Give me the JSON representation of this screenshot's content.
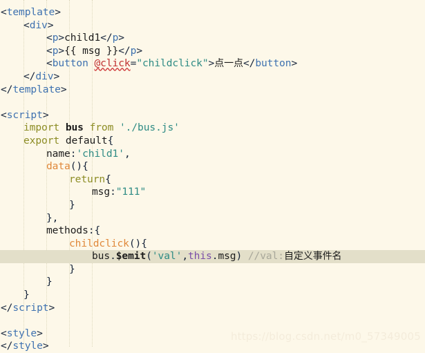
{
  "editor": {
    "language": "vue",
    "background_color": "#fdf8e9",
    "highlight_line_color": "#e3dfc9",
    "highlighted_line_number": 20
  },
  "watermark": {
    "text": "https://blog.csdn.net/m0_57349005"
  },
  "code": {
    "lines": [
      {
        "n": 1,
        "indent": 0,
        "tokens": [
          {
            "t": "punc",
            "v": "<"
          },
          {
            "t": "tag",
            "v": "template"
          },
          {
            "t": "punc",
            "v": ">"
          }
        ]
      },
      {
        "n": 2,
        "indent": 1,
        "tokens": [
          {
            "t": "punc",
            "v": "<"
          },
          {
            "t": "tag",
            "v": "div"
          },
          {
            "t": "punc",
            "v": ">"
          }
        ]
      },
      {
        "n": 3,
        "indent": 2,
        "tokens": [
          {
            "t": "punc",
            "v": "<"
          },
          {
            "t": "tag",
            "v": "p"
          },
          {
            "t": "punc",
            "v": ">"
          },
          {
            "t": "plain",
            "v": "child1"
          },
          {
            "t": "punc",
            "v": "</"
          },
          {
            "t": "tag",
            "v": "p"
          },
          {
            "t": "punc",
            "v": ">"
          }
        ]
      },
      {
        "n": 4,
        "indent": 2,
        "tokens": [
          {
            "t": "punc",
            "v": "<"
          },
          {
            "t": "tag",
            "v": "p"
          },
          {
            "t": "punc",
            "v": ">"
          },
          {
            "t": "plain",
            "v": "{{ msg }}"
          },
          {
            "t": "punc",
            "v": "</"
          },
          {
            "t": "tag",
            "v": "p"
          },
          {
            "t": "punc",
            "v": ">"
          }
        ]
      },
      {
        "n": 5,
        "indent": 2,
        "tokens": [
          {
            "t": "punc",
            "v": "<"
          },
          {
            "t": "tag",
            "v": "button"
          },
          {
            "t": "plain",
            "v": " "
          },
          {
            "t": "attr",
            "v": "@click"
          },
          {
            "t": "punc",
            "v": "="
          },
          {
            "t": "str",
            "v": "\"childclick\""
          },
          {
            "t": "punc",
            "v": ">"
          },
          {
            "t": "cjk",
            "v": "点一点"
          },
          {
            "t": "punc",
            "v": "</"
          },
          {
            "t": "tag",
            "v": "button"
          },
          {
            "t": "punc",
            "v": ">"
          }
        ]
      },
      {
        "n": 6,
        "indent": 1,
        "tokens": [
          {
            "t": "punc",
            "v": "</"
          },
          {
            "t": "tag",
            "v": "div"
          },
          {
            "t": "punc",
            "v": ">"
          }
        ]
      },
      {
        "n": 7,
        "indent": 0,
        "tokens": [
          {
            "t": "punc",
            "v": "</"
          },
          {
            "t": "tag",
            "v": "template"
          },
          {
            "t": "punc",
            "v": ">"
          }
        ]
      },
      {
        "n": 8,
        "indent": 0,
        "tokens": []
      },
      {
        "n": 9,
        "indent": 0,
        "tokens": [
          {
            "t": "punc",
            "v": "<"
          },
          {
            "t": "tag",
            "v": "script"
          },
          {
            "t": "punc",
            "v": ">"
          }
        ]
      },
      {
        "n": 10,
        "indent": 1,
        "tokens": [
          {
            "t": "kw",
            "v": "import"
          },
          {
            "t": "plain",
            "v": " "
          },
          {
            "t": "ident",
            "v": "bus"
          },
          {
            "t": "plain",
            "v": " "
          },
          {
            "t": "kw",
            "v": "from"
          },
          {
            "t": "plain",
            "v": " "
          },
          {
            "t": "str",
            "v": "'./bus.js'"
          }
        ]
      },
      {
        "n": 11,
        "indent": 1,
        "tokens": [
          {
            "t": "kw",
            "v": "export"
          },
          {
            "t": "plain",
            "v": " "
          },
          {
            "t": "plain",
            "v": "default"
          },
          {
            "t": "punc",
            "v": "{"
          }
        ]
      },
      {
        "n": 12,
        "indent": 2,
        "tokens": [
          {
            "t": "plain",
            "v": "name"
          },
          {
            "t": "punc",
            "v": ":"
          },
          {
            "t": "str",
            "v": "'child1'"
          },
          {
            "t": "punc",
            "v": ","
          }
        ]
      },
      {
        "n": 13,
        "indent": 2,
        "tokens": [
          {
            "t": "fn",
            "v": "data"
          },
          {
            "t": "punc",
            "v": "(){"
          }
        ]
      },
      {
        "n": 14,
        "indent": 3,
        "tokens": [
          {
            "t": "kw",
            "v": "return"
          },
          {
            "t": "punc",
            "v": "{"
          }
        ]
      },
      {
        "n": 15,
        "indent": 4,
        "tokens": [
          {
            "t": "plain",
            "v": "msg"
          },
          {
            "t": "punc",
            "v": ":"
          },
          {
            "t": "str",
            "v": "\"111\""
          }
        ]
      },
      {
        "n": 16,
        "indent": 3,
        "tokens": [
          {
            "t": "punc",
            "v": "}"
          }
        ]
      },
      {
        "n": 17,
        "indent": 2,
        "tokens": [
          {
            "t": "punc",
            "v": "},"
          }
        ]
      },
      {
        "n": 18,
        "indent": 2,
        "tokens": [
          {
            "t": "plain",
            "v": "methods"
          },
          {
            "t": "punc",
            "v": ":{"
          }
        ]
      },
      {
        "n": 19,
        "indent": 3,
        "tokens": [
          {
            "t": "fn",
            "v": "childclick"
          },
          {
            "t": "punc",
            "v": "(){"
          }
        ]
      },
      {
        "n": 20,
        "indent": 4,
        "highlight": true,
        "tokens": [
          {
            "t": "plain",
            "v": "bus"
          },
          {
            "t": "punc",
            "v": "."
          },
          {
            "t": "ident",
            "v": "$emit"
          },
          {
            "t": "punc",
            "v": "("
          },
          {
            "t": "str",
            "v": "'val'"
          },
          {
            "t": "punc",
            "v": ","
          },
          {
            "t": "this",
            "v": "this"
          },
          {
            "t": "punc",
            "v": "."
          },
          {
            "t": "plain",
            "v": "msg"
          },
          {
            "t": "punc",
            "v": ")"
          },
          {
            "t": "plain",
            "v": " "
          },
          {
            "t": "comment",
            "v": "//val:"
          },
          {
            "t": "comment-cjk",
            "v": "自定义事件名"
          }
        ]
      },
      {
        "n": 21,
        "indent": 3,
        "tokens": [
          {
            "t": "punc",
            "v": "}"
          }
        ]
      },
      {
        "n": 22,
        "indent": 2,
        "tokens": [
          {
            "t": "punc",
            "v": "}"
          }
        ]
      },
      {
        "n": 23,
        "indent": 1,
        "tokens": [
          {
            "t": "punc",
            "v": "}"
          }
        ]
      },
      {
        "n": 24,
        "indent": 0,
        "tokens": [
          {
            "t": "punc",
            "v": "</"
          },
          {
            "t": "tag",
            "v": "script"
          },
          {
            "t": "punc",
            "v": ">"
          }
        ]
      },
      {
        "n": 25,
        "indent": 0,
        "tokens": []
      },
      {
        "n": 26,
        "indent": 0,
        "tokens": [
          {
            "t": "punc",
            "v": "<"
          },
          {
            "t": "tag",
            "v": "style"
          },
          {
            "t": "punc",
            "v": ">"
          }
        ]
      },
      {
        "n": 27,
        "indent": 0,
        "tokens": [
          {
            "t": "punc",
            "v": "</"
          },
          {
            "t": "tag",
            "v": "style"
          },
          {
            "t": "punc",
            "v": ">"
          }
        ]
      }
    ],
    "indent_guide_columns": [
      0,
      4,
      8,
      12,
      16
    ],
    "indent_size_px": 33
  }
}
